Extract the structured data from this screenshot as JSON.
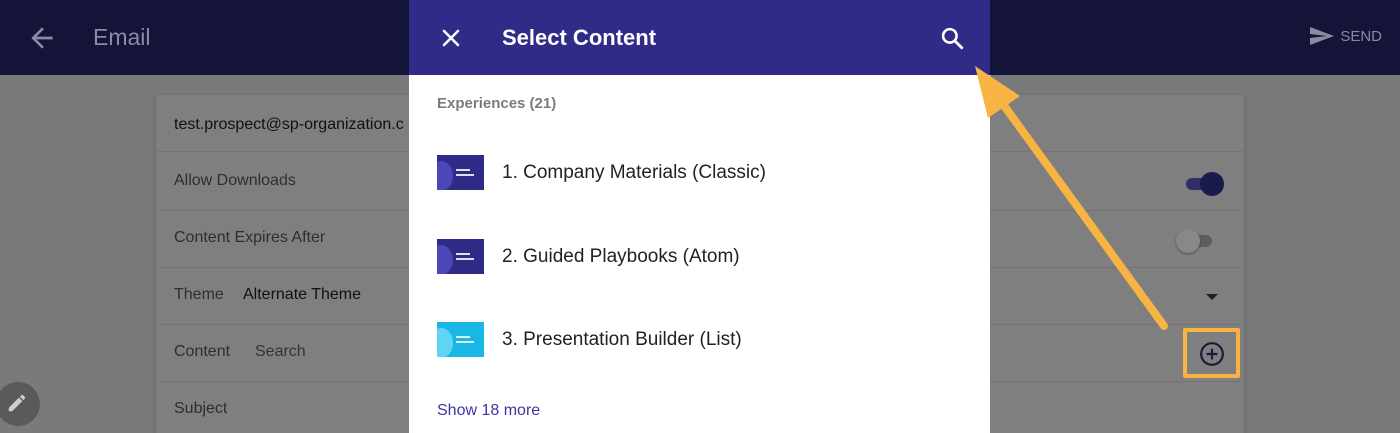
{
  "app": {
    "title": "Email",
    "send_label": "SEND"
  },
  "form": {
    "recipient": "test.prospect@sp-organization.c",
    "allow_downloads_label": "Allow Downloads",
    "allow_downloads_on": true,
    "content_expires_label": "Content Expires After",
    "content_expires_on": false,
    "theme_label": "Theme",
    "theme_value": "Alternate Theme",
    "content_label": "Content",
    "content_placeholder": "Search",
    "subject_label": "Subject"
  },
  "dialog": {
    "title": "Select Content",
    "section_label": "Experiences (21)",
    "items": [
      {
        "label": "1. Company Materials (Classic)",
        "thumb_color": "#2e2a85"
      },
      {
        "label": "2. Guided Playbooks (Atom)",
        "thumb_color": "#2e2a85"
      },
      {
        "label": "3. Presentation Builder (List)",
        "thumb_color": "#19b7e6"
      }
    ],
    "show_more": "Show 18 more"
  },
  "icons": {
    "back": "arrow-back-icon",
    "send": "send-icon",
    "close": "close-icon",
    "search": "search-icon",
    "add": "add-circle-icon",
    "edit": "pencil-icon"
  },
  "colors": {
    "header": "#302b86",
    "highlight": "#f7b443",
    "link": "#3b36a0"
  }
}
